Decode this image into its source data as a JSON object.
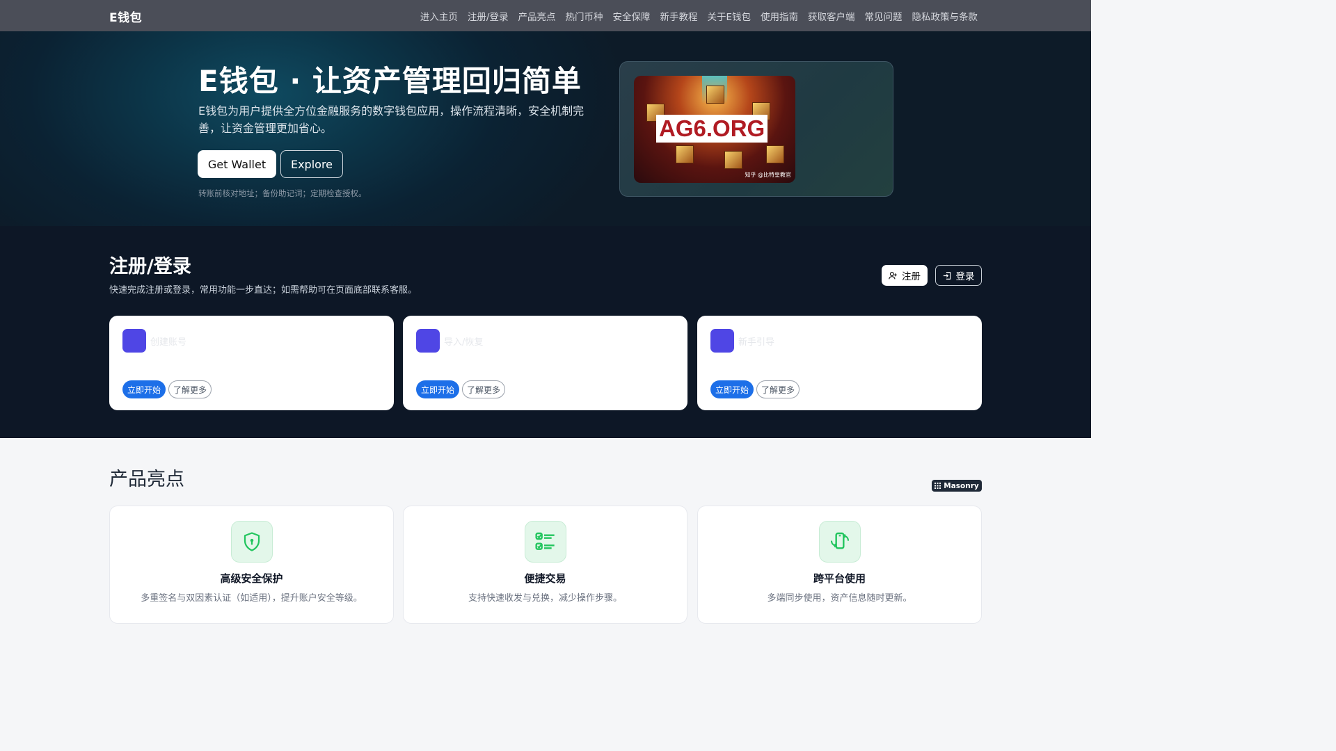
{
  "nav": {
    "brand": "E钱包",
    "links": [
      "进入主页",
      "注册/登录",
      "产品亮点",
      "热门币种",
      "安全保障",
      "新手教程",
      "关于E钱包",
      "使用指南",
      "获取客户端",
      "常见问题",
      "隐私政策与条款"
    ]
  },
  "hero": {
    "title": "E钱包 · 让资产管理回归简单",
    "lead": "E钱包为用户提供全方位金融服务的数字钱包应用，操作流程清晰，安全机制完善，让资金管理更加省心。",
    "primary_button": "Get Wallet",
    "secondary_button": "Explore",
    "tip": "转账前核对地址；备份助记词；定期检查授权。",
    "image_label": "AG6.ORG",
    "image_credit": "知乎 @比特皇教官"
  },
  "register": {
    "title": "注册/登录",
    "desc": "快速完成注册或登录，常用功能一步直达；如需帮助可在页面底部联系客服。",
    "signup_button": "注册",
    "login_button": "登录",
    "cards": [
      {
        "title": "创建账号",
        "start": "立即开始",
        "more": "了解更多"
      },
      {
        "title": "导入/恢复",
        "start": "立即开始",
        "more": "了解更多"
      },
      {
        "title": "新手引导",
        "start": "立即开始",
        "more": "了解更多"
      }
    ]
  },
  "features": {
    "title": "产品亮点",
    "badge": "Masonry",
    "cards": [
      {
        "icon": "shield-lock-icon",
        "title": "高级安全保护",
        "desc": "多重签名与双因素认证（如适用），提升账户安全等级。"
      },
      {
        "icon": "checklist-icon",
        "title": "便捷交易",
        "desc": "支持快速收发与兑换，减少操作步骤。"
      },
      {
        "icon": "phone-sync-icon",
        "title": "跨平台使用",
        "desc": "多端同步使用，资产信息随时更新。"
      }
    ]
  },
  "colors": {
    "nav_bg": "#4b4e58",
    "hero_bg": "#0c3447",
    "section_dark": "#0d1726",
    "card_icon": "#4f46e5",
    "primary_blue": "#1d6fe8",
    "feature_green": "#22c55e"
  }
}
